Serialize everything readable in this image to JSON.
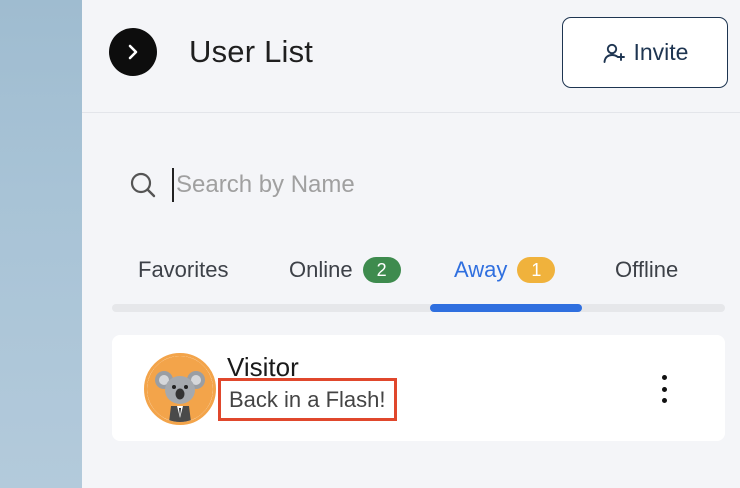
{
  "header": {
    "title": "User List",
    "invite_label": "Invite",
    "expand_icon": "chevron-right-icon",
    "invite_icon": "user-plus-icon"
  },
  "search": {
    "placeholder": "Search by Name",
    "value": "",
    "icon": "search-icon"
  },
  "tabs": [
    {
      "label": "Favorites",
      "badge": null,
      "active": false
    },
    {
      "label": "Online",
      "badge": "2",
      "badge_color": "#3e8b4e",
      "active": false
    },
    {
      "label": "Away",
      "badge": "1",
      "badge_color": "#f0b23c",
      "active": true
    },
    {
      "label": "Offline",
      "badge": null,
      "active": false
    }
  ],
  "colors": {
    "accent": "#2f6fdf",
    "highlight_border": "#e0472c",
    "avatar_ring": "#f3a44a",
    "primary_dark": "#1e3551"
  },
  "users": [
    {
      "name": "Visitor",
      "status": "Back in a Flash!",
      "avatar": "koala-avatar",
      "menu_icon": "more-vertical-icon"
    }
  ]
}
